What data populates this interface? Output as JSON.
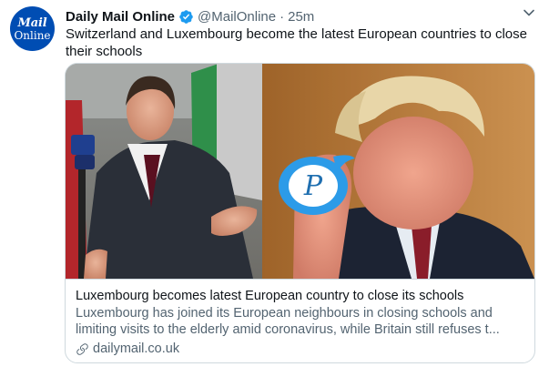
{
  "account": {
    "avatar_text_1": "Mail",
    "avatar_text_2": "Online",
    "display_name": "Daily Mail Online",
    "handle": "@MailOnline",
    "separator": "·",
    "time": "25m"
  },
  "tweet": {
    "text": "Switzerland and Luxembourg become the latest European countries to close their schools"
  },
  "card": {
    "title": "Luxembourg becomes latest European country to close its schools",
    "description_line1": "Luxembourg has joined its European neighbours in closing schools and",
    "description_line2": "limiting visits to the elderly amid coronavirus, while Britain still refuses t...",
    "domain": "dailymail.co.uk"
  },
  "watermark": {
    "letter": "P"
  },
  "icons": [
    "verified-badge-icon",
    "caret-down-icon",
    "link-icon",
    "bird-logo-icon"
  ],
  "colors": {
    "accent": "#1d9bf0",
    "avatar_bg": "#004db3",
    "secondary_text": "#536471",
    "border": "#cfd9de"
  }
}
